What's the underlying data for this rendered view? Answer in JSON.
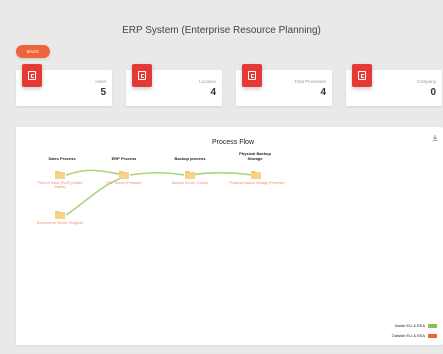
{
  "header": {
    "title": "ERP System (Enterprise Resource Planning)"
  },
  "back_button": {
    "label": "BACK"
  },
  "stats": [
    {
      "label": "Asset",
      "value": "5"
    },
    {
      "label": "Location",
      "value": "4"
    },
    {
      "label": "Total Processes",
      "value": "4"
    },
    {
      "label": "Company",
      "value": "0"
    }
  ],
  "flow": {
    "title": "Process Flow",
    "columns": [
      {
        "label": "Sales Process"
      },
      {
        "label": "ERP Process"
      },
      {
        "label": "Backup process"
      },
      {
        "label": "Physical Backup Storage"
      }
    ],
    "nodes": [
      {
        "label": "Point of Sales (PoS) (United States)"
      },
      {
        "label": "ERP Server (Premise)"
      },
      {
        "label": "Backup Server (Cloud)"
      },
      {
        "label": "Physical backup storage (Premise)"
      },
      {
        "label": "Ecommerce Server (Original)"
      }
    ],
    "legend": [
      {
        "label": "Inside EU & EEA",
        "color": "#8bc34a"
      },
      {
        "label": "Outside EU & EEA",
        "color": "#f0643a"
      }
    ],
    "colors": {
      "node": "#f5c66f",
      "node_dark": "#e0a94a",
      "link": "#9ccc65",
      "label": "#f28c6b"
    }
  }
}
